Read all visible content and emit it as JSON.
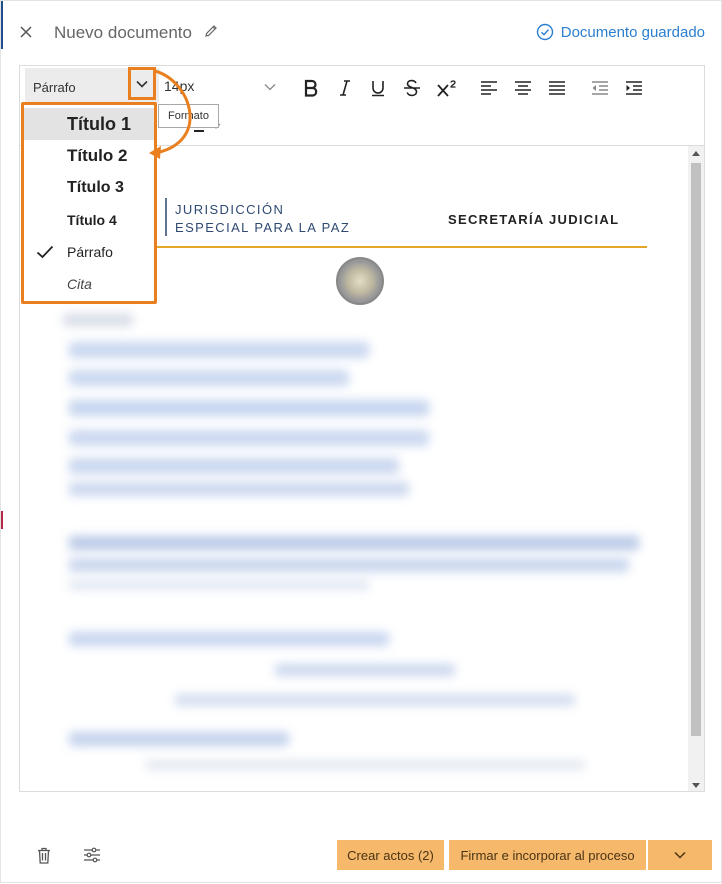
{
  "header": {
    "title": "Nuevo documento",
    "saved_status": "Documento guardado"
  },
  "toolbar": {
    "format_value": "Párrafo",
    "font_size_value": "14px",
    "tooltip": "Formato",
    "format_options": [
      {
        "label": "Título 1",
        "selected": false,
        "highlighted": true
      },
      {
        "label": "Título 2",
        "selected": false,
        "highlighted": false
      },
      {
        "label": "Título 3",
        "selected": false,
        "highlighted": false
      },
      {
        "label": "Título 4",
        "selected": false,
        "highlighted": false
      },
      {
        "label": "Párrafo",
        "selected": true,
        "highlighted": false
      },
      {
        "label": "Cita",
        "selected": false,
        "highlighted": false
      }
    ],
    "buttons": [
      "bold-icon",
      "italic-icon",
      "underline-icon",
      "strikethrough-icon",
      "superscript-icon",
      "align-left-icon",
      "align-center-icon",
      "align-justify-icon",
      "outdent-icon",
      "indent-icon"
    ]
  },
  "document": {
    "jurisdiction_line1": "JURISDICCIÓN",
    "jurisdiction_line2": "ESPECIAL PARA LA PAZ",
    "secretaria": "SECRETARÍA JUDICIAL"
  },
  "footer": {
    "create_acts_label": "Crear actos (2)",
    "sign_label": "Firmar e incorporar al proceso"
  },
  "colors": {
    "accent_orange": "#e97f1e",
    "saved_blue": "#2b7fd0",
    "button_orange": "#f6b96c",
    "header_gold": "#e3a52a",
    "jurisdiction_blue": "#2f4a72"
  }
}
